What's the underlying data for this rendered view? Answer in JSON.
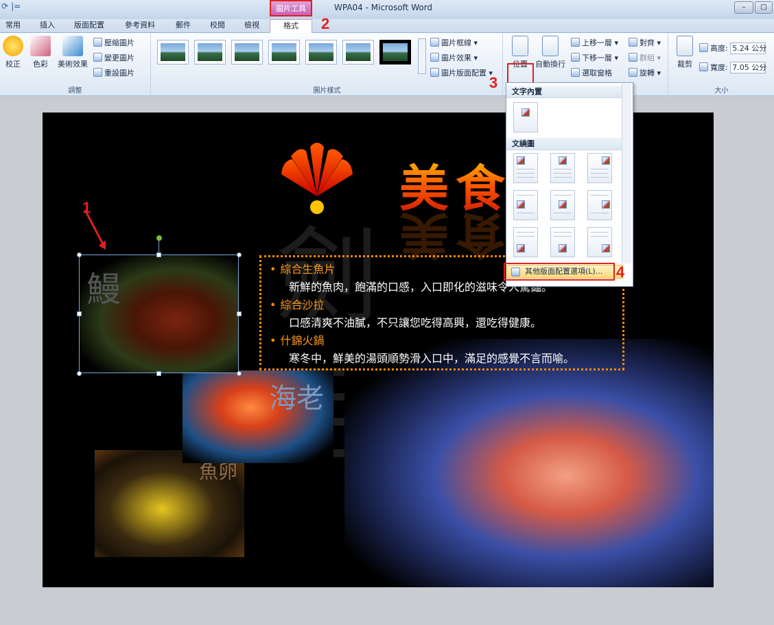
{
  "window": {
    "title": "WPA04 - Microsoft Word",
    "context_tab_group": "圖片工具",
    "qat_items": [
      "⟳",
      "|="
    ]
  },
  "tabs": [
    "常用",
    "插入",
    "版面配置",
    "參考資料",
    "郵件",
    "校閱",
    "檢視",
    "格式"
  ],
  "ribbon": {
    "adjust": {
      "label": "調整",
      "correct": "校正",
      "color": "色彩",
      "artistic": "美術效果",
      "compress": "壓縮圖片",
      "change": "變更圖片",
      "reset": "重設圖片"
    },
    "picture_styles": {
      "label": "圖片樣式",
      "border": "圖片框線",
      "effects": "圖片效果",
      "layout": "圖片版面配置"
    },
    "arrange": {
      "position": "位置",
      "wrap": "自動換行",
      "bring_forward": "上移一層",
      "send_backward": "下移一層",
      "selection_pane": "選取窗格",
      "align": "對齊",
      "group": "群組",
      "rotate": "旋轉"
    },
    "size": {
      "label": "大小",
      "crop": "裁剪",
      "height_label": "高度:",
      "height_value": "5.24 公分",
      "width_label": "寬度:",
      "width_value": "7.05 公分"
    }
  },
  "dropdown": {
    "inline_header": "文字內置",
    "wrap_header": "文繞圖",
    "more_options": "其他版面配置選項(L)..."
  },
  "document": {
    "title_text": "美食天堂",
    "bullets": [
      {
        "head": "綜合生魚片",
        "desc": "新鮮的魚肉，飽滿的口感，入口即化的滋味令人驚豔。"
      },
      {
        "head": "綜合沙拉",
        "desc": "口感清爽不油膩，不只讓您吃得高興，還吃得健康。"
      },
      {
        "head": "什錦火鍋",
        "desc": "寒冬中，鮮美的湯頭順勢滑入口中，滿足的感覺不言而喻。"
      }
    ],
    "eel_mark": "鰻",
    "shrimp_mark": "海老",
    "roe_mark": "魚卵"
  },
  "annotations": {
    "n1": "1",
    "n2": "2",
    "n3": "3",
    "n4": "4"
  }
}
